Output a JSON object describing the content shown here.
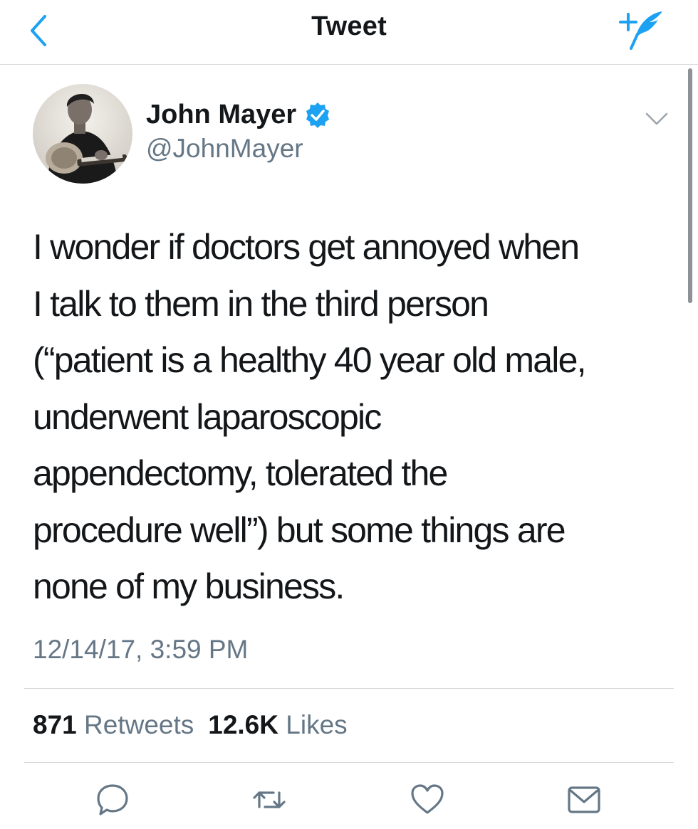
{
  "header": {
    "title": "Tweet",
    "back_icon": "chevron-left-icon",
    "compose_icon": "compose-tweet-icon",
    "accent_color": "#1da1f2"
  },
  "tweet": {
    "author": {
      "display_name": "John Mayer",
      "handle": "@JohnMayer",
      "verified": true
    },
    "text": "I wonder if doctors get annoyed when\nI talk to them in the third person\n(“patient is a healthy 40 year old male,\nunderwent laparoscopic\nappendectomy, tolerated the\nprocedure well”) but some things are\nnone of my business.",
    "timestamp": "12/14/17, 3:59 PM",
    "retweets": {
      "count": "871",
      "label": "Retweets"
    },
    "likes": {
      "count": "12.6K",
      "label": "Likes"
    }
  },
  "actions": [
    "reply-icon",
    "retweet-icon",
    "like-icon",
    "share-icon"
  ],
  "colors": {
    "text_primary": "#14171a",
    "text_secondary": "#657786",
    "divider": "#d6d9dc",
    "icon_gray": "#657786"
  }
}
